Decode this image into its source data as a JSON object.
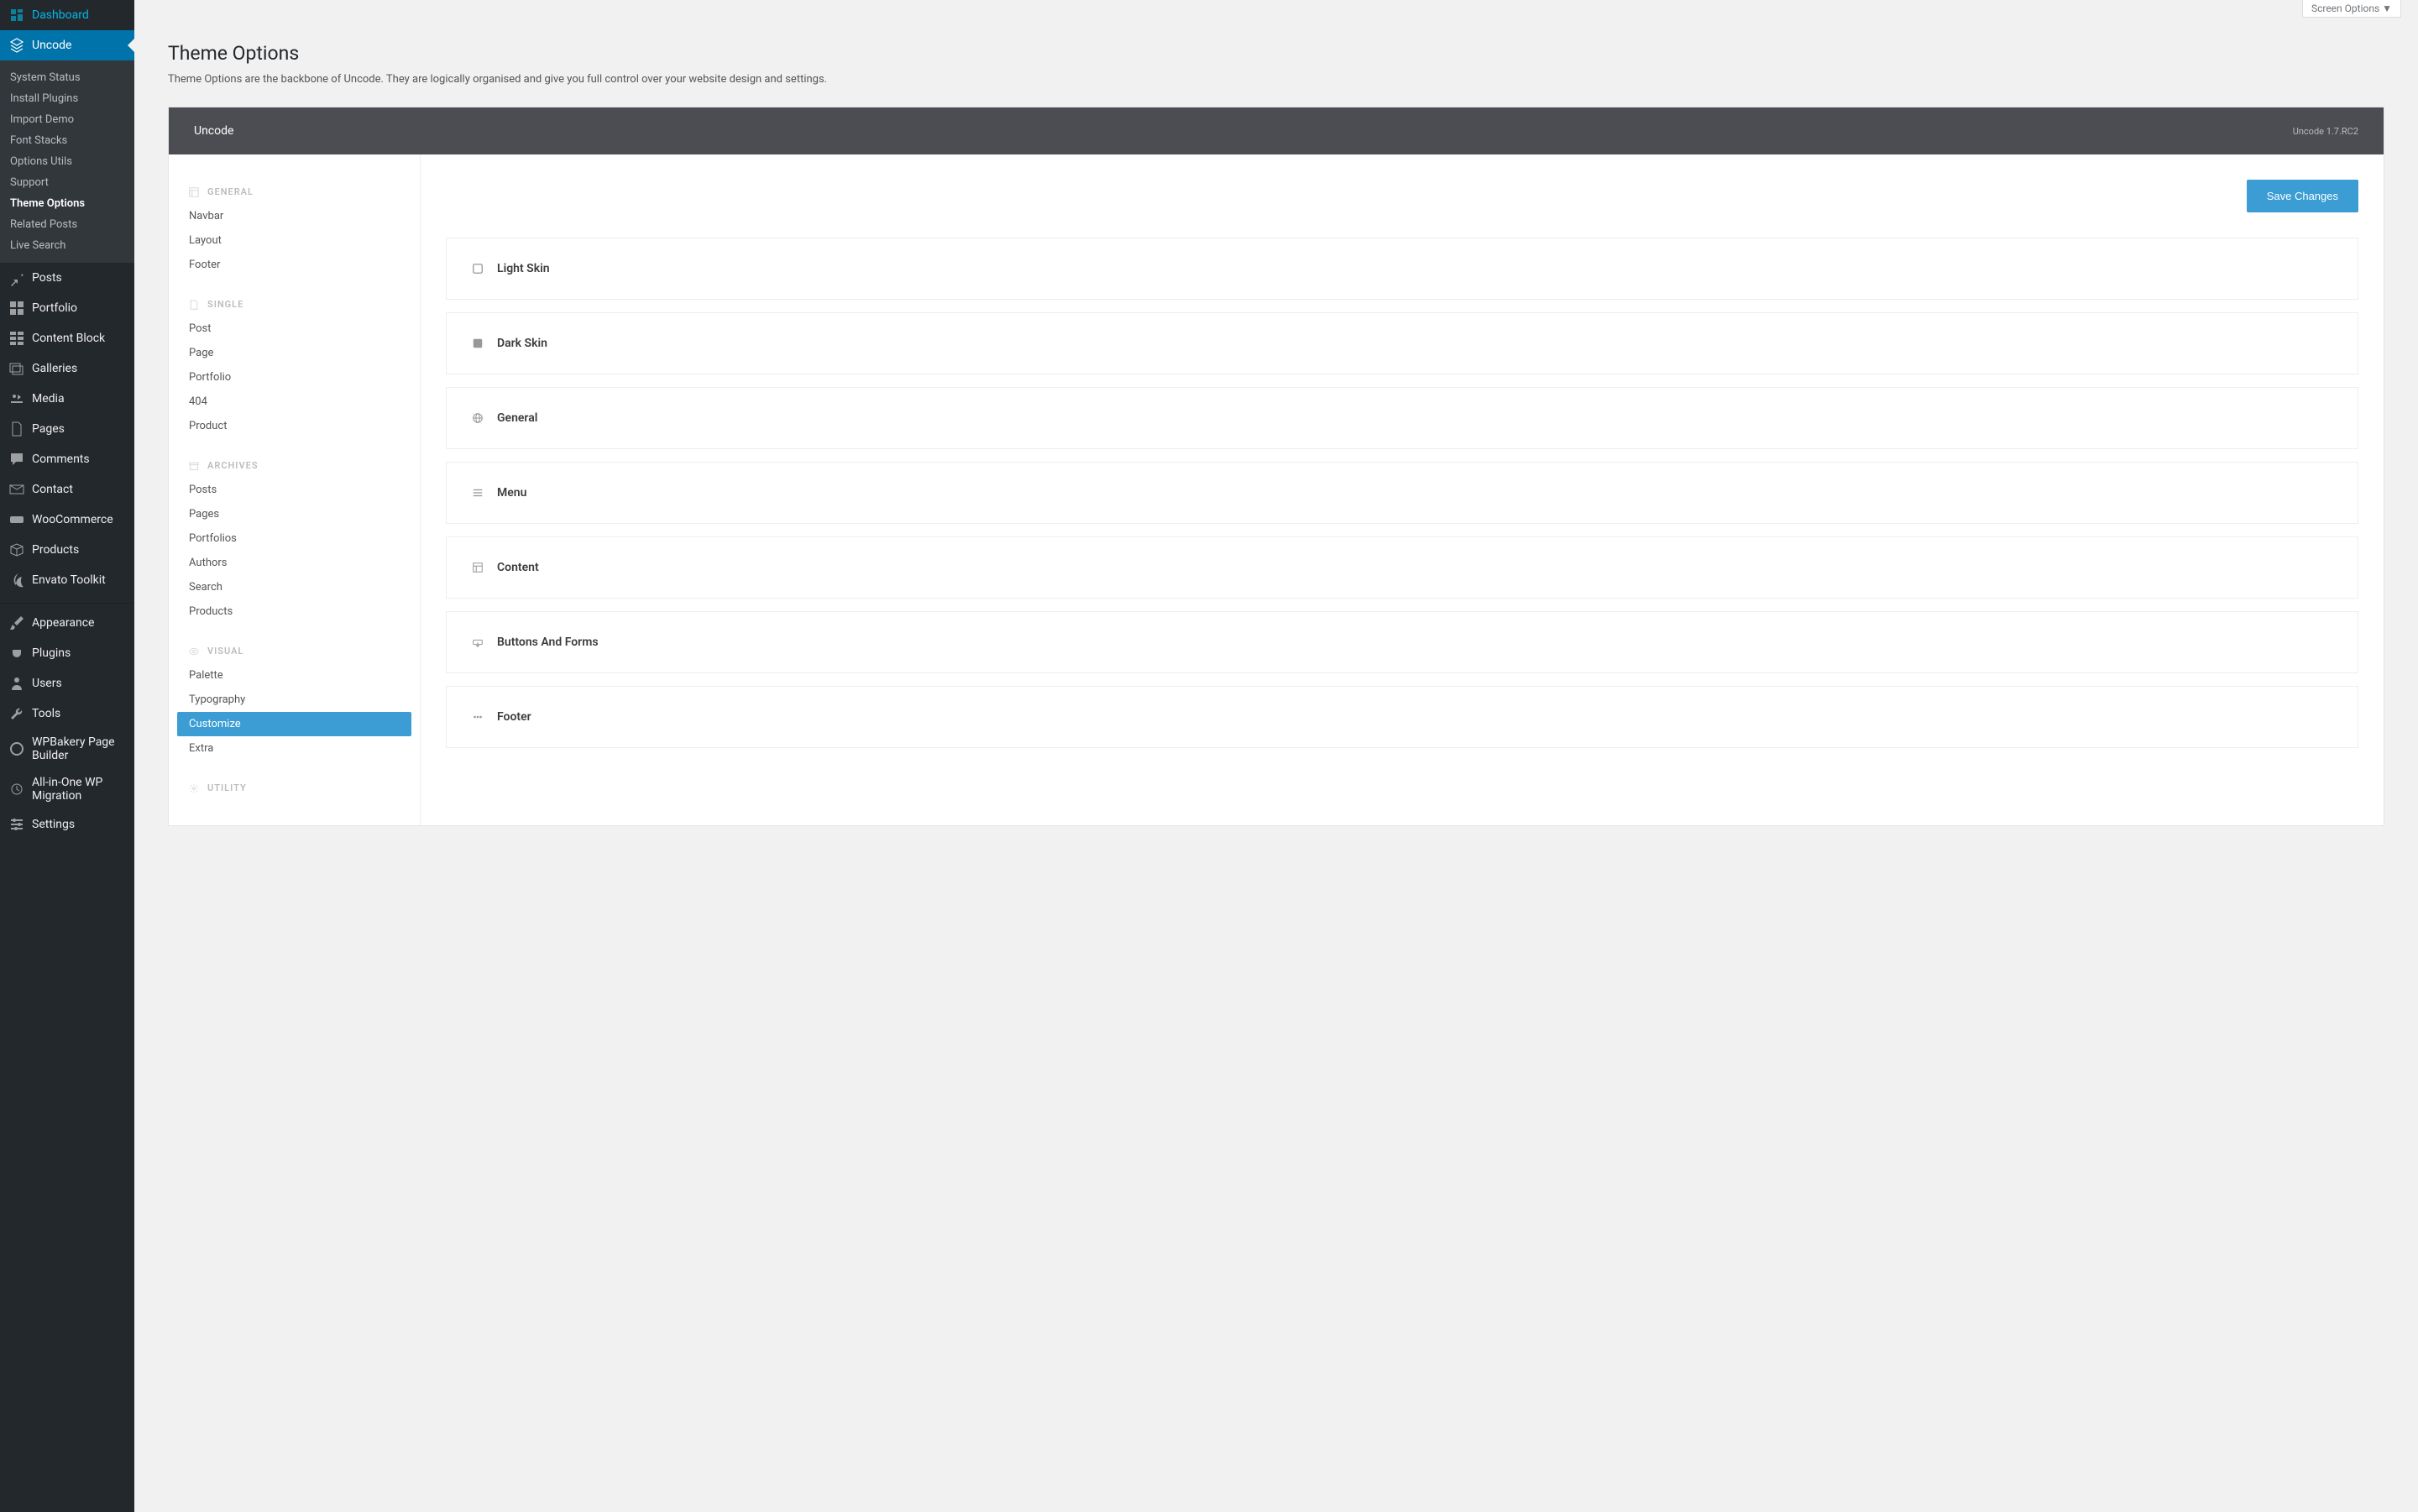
{
  "screen_options": "Screen Options ▼",
  "page": {
    "title": "Theme Options",
    "description": "Theme Options are the backbone of Uncode. They are logically organised and give you full control over your website design and settings."
  },
  "panel": {
    "title": "Uncode",
    "version": "Uncode 1.7.RC2",
    "save_button": "Save Changes"
  },
  "wp_menu": [
    {
      "label": "Dashboard",
      "icon": "dashboard"
    },
    {
      "label": "Uncode",
      "icon": "uncode",
      "current": true,
      "submenu": [
        {
          "label": "System Status"
        },
        {
          "label": "Install Plugins"
        },
        {
          "label": "Import Demo"
        },
        {
          "label": "Font Stacks"
        },
        {
          "label": "Options Utils"
        },
        {
          "label": "Support"
        },
        {
          "label": "Theme Options",
          "current": true
        },
        {
          "label": "Related Posts"
        },
        {
          "label": "Live Search"
        }
      ]
    },
    {
      "label": "Posts",
      "icon": "pin"
    },
    {
      "label": "Portfolio",
      "icon": "grid"
    },
    {
      "label": "Content Block",
      "icon": "blocks"
    },
    {
      "label": "Galleries",
      "icon": "gallery"
    },
    {
      "label": "Media",
      "icon": "media"
    },
    {
      "label": "Pages",
      "icon": "page"
    },
    {
      "label": "Comments",
      "icon": "comment"
    },
    {
      "label": "Contact",
      "icon": "mail"
    },
    {
      "label": "WooCommerce",
      "icon": "woo"
    },
    {
      "label": "Products",
      "icon": "box"
    },
    {
      "label": "Envato Toolkit",
      "icon": "envato"
    },
    {
      "separator": true
    },
    {
      "label": "Appearance",
      "icon": "brush"
    },
    {
      "label": "Plugins",
      "icon": "plug"
    },
    {
      "label": "Users",
      "icon": "user"
    },
    {
      "label": "Tools",
      "icon": "wrench"
    },
    {
      "label": "WPBakery Page Builder",
      "icon": "wpb"
    },
    {
      "label": "All-in-One WP Migration",
      "icon": "migration"
    },
    {
      "label": "Settings",
      "icon": "settings"
    }
  ],
  "opt_sections": [
    {
      "head": "General",
      "icon": "layout",
      "items": [
        {
          "label": "Navbar"
        },
        {
          "label": "Layout"
        },
        {
          "label": "Footer"
        }
      ]
    },
    {
      "head": "Single",
      "icon": "file",
      "items": [
        {
          "label": "Post"
        },
        {
          "label": "Page"
        },
        {
          "label": "Portfolio"
        },
        {
          "label": "404"
        },
        {
          "label": "Product"
        }
      ]
    },
    {
      "head": "Archives",
      "icon": "archive",
      "items": [
        {
          "label": "Posts"
        },
        {
          "label": "Pages"
        },
        {
          "label": "Portfolios"
        },
        {
          "label": "Authors"
        },
        {
          "label": "Search"
        },
        {
          "label": "Products"
        }
      ]
    },
    {
      "head": "Visual",
      "icon": "eye",
      "items": [
        {
          "label": "Palette"
        },
        {
          "label": "Typography"
        },
        {
          "label": "Customize",
          "active": true
        },
        {
          "label": "Extra"
        }
      ]
    },
    {
      "head": "Utility",
      "icon": "gear",
      "items": []
    }
  ],
  "content_rows": [
    {
      "label": "Light Skin",
      "icon": "square-empty"
    },
    {
      "label": "Dark Skin",
      "icon": "square-fill"
    },
    {
      "label": "General",
      "icon": "globe"
    },
    {
      "label": "Menu",
      "icon": "menu"
    },
    {
      "label": "Content",
      "icon": "layout2"
    },
    {
      "label": "Buttons And Forms",
      "icon": "button"
    },
    {
      "label": "Footer",
      "icon": "dots"
    }
  ]
}
